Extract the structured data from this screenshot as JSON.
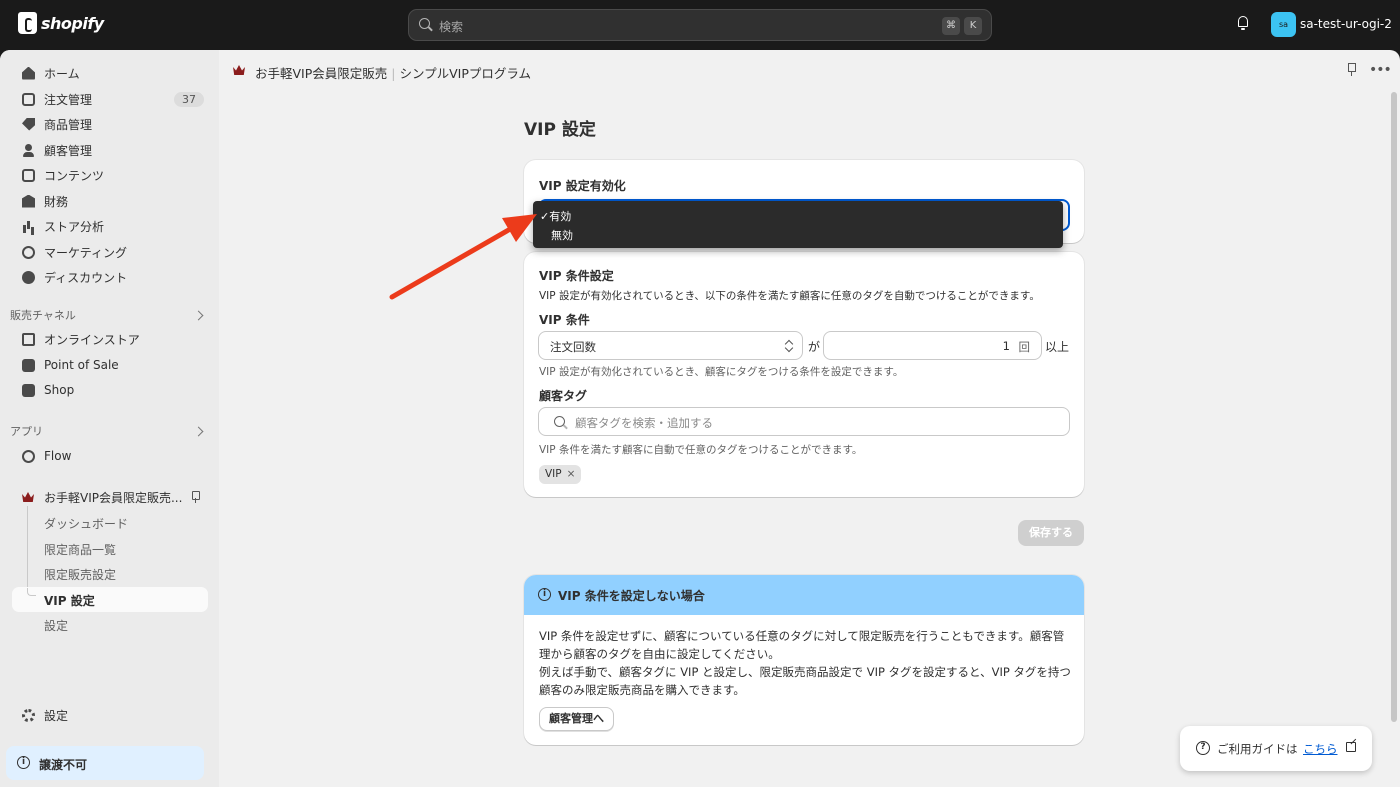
{
  "topbar": {
    "brand": "shopify",
    "search_placeholder": "検索",
    "kbd_cmd": "⌘",
    "kbd_k": "K",
    "store_initials": "sa",
    "store_name": "sa-test-ur-ogi-2"
  },
  "sidebar": {
    "items": [
      {
        "label": "ホーム",
        "icon": "home-icon"
      },
      {
        "label": "注文管理",
        "icon": "inbox-icon",
        "badge": "37"
      },
      {
        "label": "商品管理",
        "icon": "tag-icon"
      },
      {
        "label": "顧客管理",
        "icon": "person-icon"
      },
      {
        "label": "コンテンツ",
        "icon": "content-icon"
      },
      {
        "label": "財務",
        "icon": "bank-icon"
      },
      {
        "label": "ストア分析",
        "icon": "chart-icon"
      },
      {
        "label": "マーケティング",
        "icon": "target-icon"
      },
      {
        "label": "ディスカウント",
        "icon": "discount-icon"
      }
    ],
    "sales_channels_title": "販売チャネル",
    "sales_channels": [
      {
        "label": "オンラインストア",
        "icon": "store-icon"
      },
      {
        "label": "Point of Sale",
        "icon": "pos-icon"
      },
      {
        "label": "Shop",
        "icon": "shop-icon"
      }
    ],
    "apps_title": "アプリ",
    "apps": [
      {
        "label": "Flow",
        "icon": "flow-icon"
      }
    ],
    "app_name": "お手軽VIP会員限定販売...",
    "app_subitems": [
      "ダッシュボード",
      "限定商品一覧",
      "限定販売設定",
      "VIP 設定",
      "設定"
    ],
    "settings_label": "設定",
    "transfer_label": "譲渡不可"
  },
  "header": {
    "breadcrumb_app": "お手軽VIP会員限定販売",
    "breadcrumb_sep": "|",
    "breadcrumb_page": "シンプルVIPプログラム",
    "more": "•••"
  },
  "page": {
    "title": "VIP 設定",
    "enable_card": {
      "label": "VIP 設定有効化",
      "options": [
        "有効",
        "無効"
      ],
      "selected": "有効",
      "check": "✓"
    },
    "conditions_card": {
      "title": "VIP 条件設定",
      "description": "VIP 設定が有効化されているとき、以下の条件を満たす顧客に任意のタグを自動でつけることができます。",
      "condition_label": "VIP 条件",
      "condition_select": "注文回数",
      "ga": "が",
      "count_value": "1",
      "count_unit": "回",
      "ijou": "以上",
      "condition_help": "VIP 設定が有効化されているとき、顧客にタグをつける条件を設定できます。",
      "tag_label": "顧客タグ",
      "tag_placeholder": "顧客タグを検索・追加する",
      "tag_help": "VIP 条件を満たす顧客に自動で任意のタグをつけることができます。",
      "tags": [
        "VIP"
      ],
      "chip_remove": "×"
    },
    "save_button": "保存する",
    "banner": {
      "title": "VIP 条件を設定しない場合",
      "line1": "VIP 条件を設定せずに、顧客についている任意のタグに対して限定販売を行うこともできます。顧客管理から顧客のタグを自由に設定してください。",
      "line2": "例えば手動で、顧客タグに VIP と設定し、限定販売商品設定で VIP タグを設定すると、VIP タグを持つ顧客のみ限定販売商品を購入できます。",
      "button": "顧客管理へ"
    },
    "guide": {
      "text": "ご利用ガイドは",
      "link": "こちら",
      "q": "?"
    }
  },
  "colors": {
    "accent": "#005bd3",
    "banner": "#91d0ff",
    "annotation_arrow": "#ec3b1b"
  }
}
